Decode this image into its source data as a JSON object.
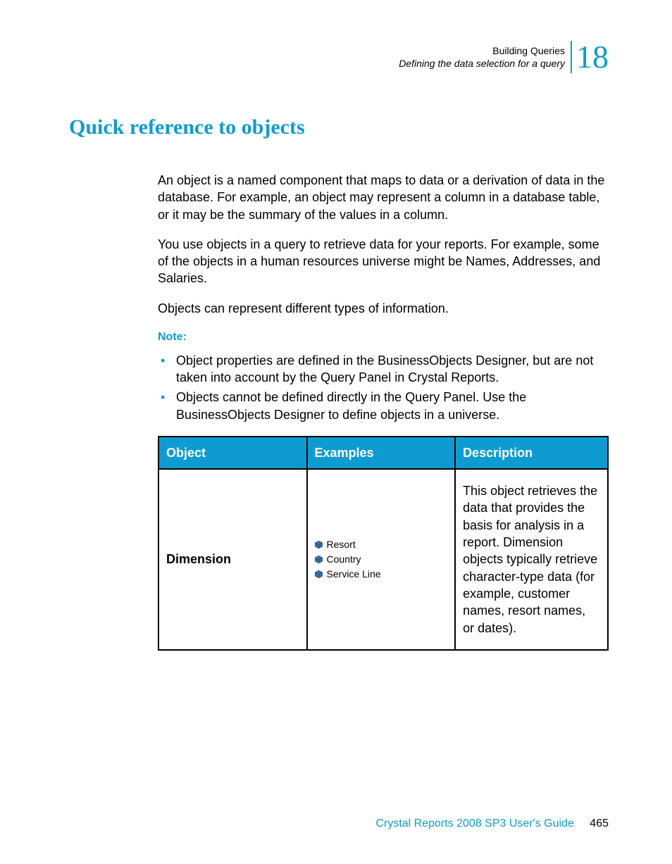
{
  "header": {
    "line1": "Building Queries",
    "line2": "Defining the data selection for a query",
    "chapter_number": "18"
  },
  "heading": "Quick reference to objects",
  "paragraphs": {
    "p1": "An object is a named component that maps to data or a derivation of data in the database. For example, an object may represent a column in a database table, or it may be the summary of the values in a column.",
    "p2": "You use objects in a query to retrieve data for your reports. For example, some of the objects in a human resources universe might be Names, Addresses, and Salaries.",
    "p3": "Objects can represent different types of information."
  },
  "note_label": "Note:",
  "bullets": [
    "Object properties are defined in the BusinessObjects Designer, but are not taken into account by the Query Panel in Crystal Reports.",
    "Objects cannot be defined directly in the Query Panel. Use the BusinessObjects Designer to define objects in a universe."
  ],
  "table": {
    "headers": {
      "c1": "Object",
      "c2": "Examples",
      "c3": "Description"
    },
    "row1": {
      "object": "Dimension",
      "examples": [
        "Resort",
        "Country",
        "Service Line"
      ],
      "description": "This object retrieves the data that provides the basis for analysis in a report. Dimension objects typically retrieve character-type data (for example, customer names, resort names, or dates)."
    }
  },
  "footer": {
    "title": "Crystal Reports 2008 SP3 User's Guide",
    "page": "465"
  }
}
